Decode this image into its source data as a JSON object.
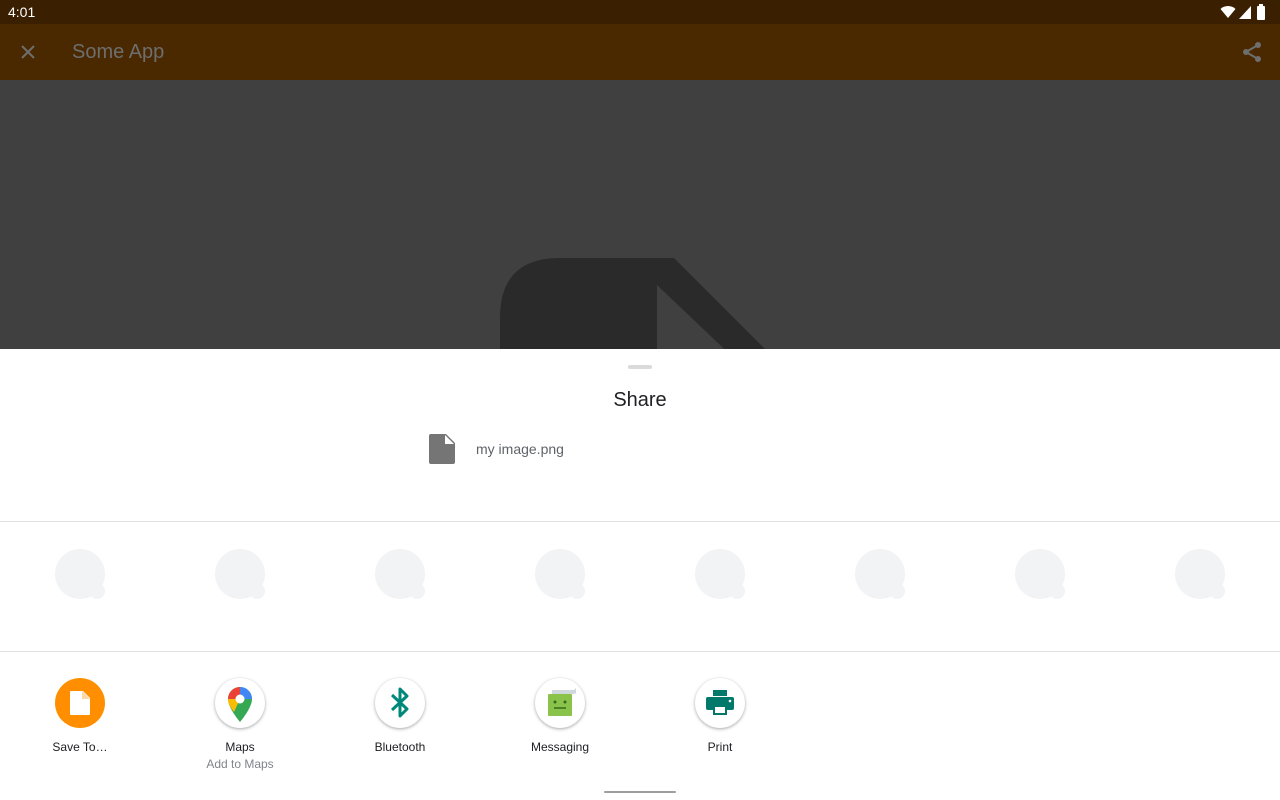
{
  "status_bar": {
    "time": "4:01"
  },
  "app_bar": {
    "title": "Some App"
  },
  "share_sheet": {
    "title": "Share",
    "file_name": "my image.png",
    "targets": [
      {
        "label": "Save To…",
        "sublabel": "",
        "icon": "file-icon",
        "color": "#ff8f00"
      },
      {
        "label": "Maps",
        "sublabel": "Add to Maps",
        "icon": "maps-pin-icon",
        "color": "#34a853"
      },
      {
        "label": "Bluetooth",
        "sublabel": "",
        "icon": "bluetooth-icon",
        "color": "#00897b"
      },
      {
        "label": "Messaging",
        "sublabel": "",
        "icon": "messaging-icon",
        "color": "#8bc34a"
      },
      {
        "label": "Print",
        "sublabel": "",
        "icon": "print-icon",
        "color": "#00796b"
      }
    ]
  }
}
